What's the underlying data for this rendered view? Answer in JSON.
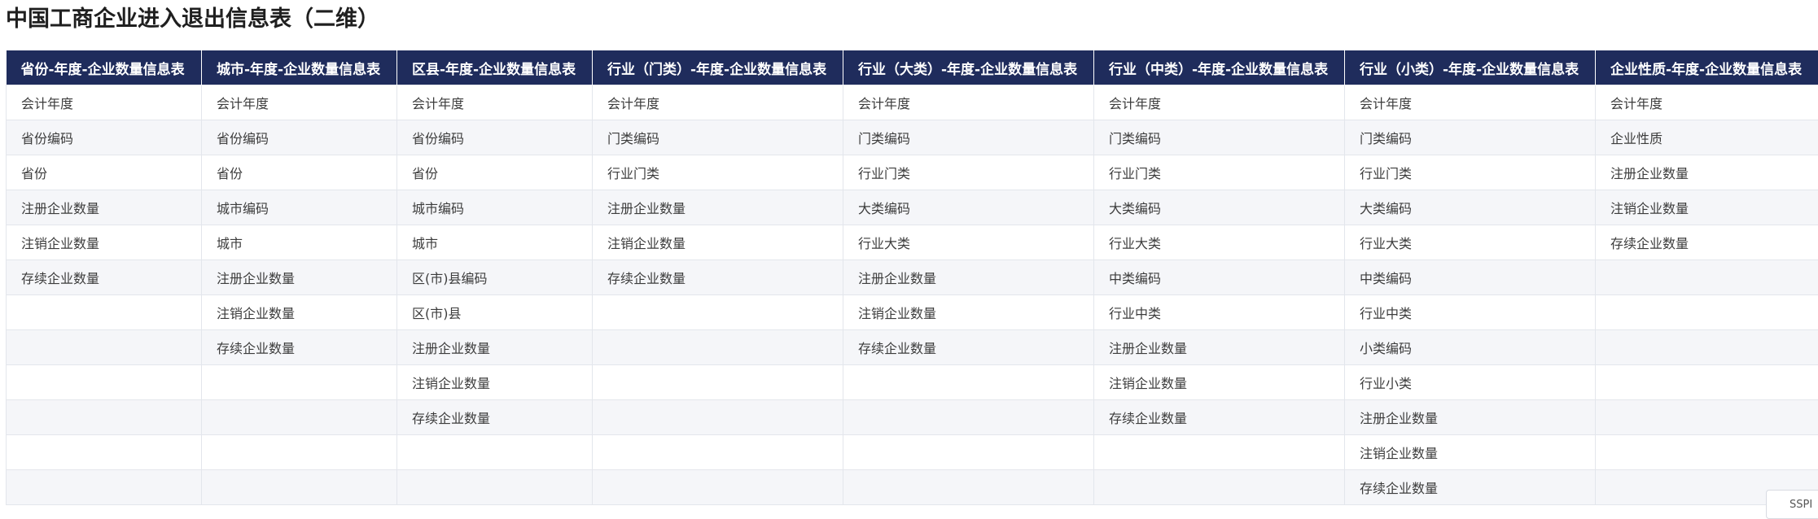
{
  "page": {
    "title": "中国工商企业进入退出信息表（二维）"
  },
  "table": {
    "headers": [
      "省份-年度-企业数量信息表",
      "城市-年度-企业数量信息表",
      "区县-年度-企业数量信息表",
      "行业（门类）-年度-企业数量信息表",
      "行业（大类）-年度-企业数量信息表",
      "行业（中类）-年度-企业数量信息表",
      "行业（小类）-年度-企业数量信息表",
      "企业性质-年度-企业数量信息表"
    ],
    "rows": [
      [
        "会计年度",
        "会计年度",
        "会计年度",
        "会计年度",
        "会计年度",
        "会计年度",
        "会计年度",
        "会计年度"
      ],
      [
        "省份编码",
        "省份编码",
        "省份编码",
        "门类编码",
        "门类编码",
        "门类编码",
        "门类编码",
        "企业性质"
      ],
      [
        "省份",
        "省份",
        "省份",
        "行业门类",
        "行业门类",
        "行业门类",
        "行业门类",
        "注册企业数量"
      ],
      [
        "注册企业数量",
        "城市编码",
        "城市编码",
        "注册企业数量",
        "大类编码",
        "大类编码",
        "大类编码",
        "注销企业数量"
      ],
      [
        "注销企业数量",
        "城市",
        "城市",
        "注销企业数量",
        "行业大类",
        "行业大类",
        "行业大类",
        "存续企业数量"
      ],
      [
        "存续企业数量",
        "注册企业数量",
        "区(市)县编码",
        "存续企业数量",
        "注册企业数量",
        "中类编码",
        "中类编码",
        ""
      ],
      [
        "",
        "注销企业数量",
        "区(市)县",
        "",
        "注销企业数量",
        "行业中类",
        "行业中类",
        ""
      ],
      [
        "",
        "存续企业数量",
        "注册企业数量",
        "",
        "存续企业数量",
        "注册企业数量",
        "小类编码",
        ""
      ],
      [
        "",
        "",
        "注销企业数量",
        "",
        "",
        "注销企业数量",
        "行业小类",
        ""
      ],
      [
        "",
        "",
        "存续企业数量",
        "",
        "",
        "存续企业数量",
        "注册企业数量",
        ""
      ],
      [
        "",
        "",
        "",
        "",
        "",
        "",
        "注销企业数量",
        ""
      ],
      [
        "",
        "",
        "",
        "",
        "",
        "",
        "存续企业数量",
        ""
      ]
    ]
  },
  "corner_badge": {
    "text": "SSPI"
  },
  "colors": {
    "header_bg": "#1f2c5c",
    "header_text": "#ffffff",
    "row_alt_bg": "#f5f6f9",
    "border": "#e3e6ec"
  }
}
